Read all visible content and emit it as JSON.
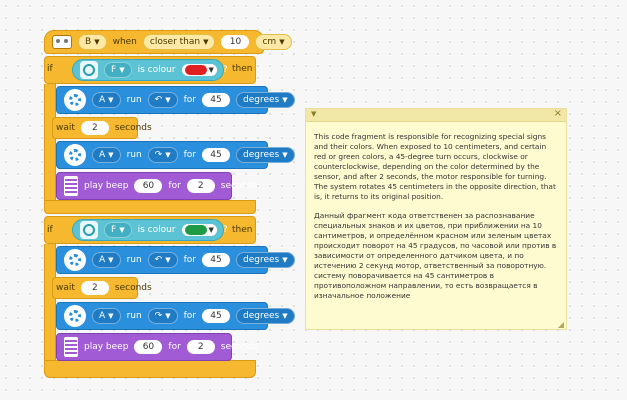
{
  "program": {
    "trigger": {
      "port": "B",
      "when_label": "when",
      "condition": "closer than",
      "value": "10",
      "unit": "cm"
    },
    "if1": {
      "if_label": "if",
      "then_label": "then",
      "port": "F",
      "cond_label": "is colour",
      "color": "#e02020",
      "q": "?",
      "motor1": {
        "port": "A",
        "run_label": "run",
        "for_label": "for",
        "value": "45",
        "unit": "degrees"
      },
      "wait": {
        "label": "wait",
        "value": "2",
        "unit": "seconds"
      },
      "motor2": {
        "port": "A",
        "run_label": "run",
        "for_label": "for",
        "value": "45",
        "unit": "degrees"
      },
      "beep": {
        "label": "play beep",
        "note": "60",
        "for_label": "for",
        "value": "2",
        "unit": "seconds"
      }
    },
    "if2": {
      "if_label": "if",
      "then_label": "then",
      "port": "F",
      "cond_label": "is colour",
      "color": "#1f9a45",
      "q": "?",
      "motor1": {
        "port": "A",
        "run_label": "run",
        "for_label": "for",
        "value": "45",
        "unit": "degrees"
      },
      "wait": {
        "label": "wait",
        "value": "2",
        "unit": "seconds"
      },
      "motor2": {
        "port": "A",
        "run_label": "run",
        "for_label": "for",
        "value": "45",
        "unit": "degrees"
      },
      "beep": {
        "label": "play beep",
        "note": "60",
        "for_label": "for",
        "value": "2",
        "unit": "seconds"
      }
    }
  },
  "note": {
    "paragraph_en": "This code fragment is responsible for recognizing special signs and their colors. When exposed to 10 centimeters, and certain red or green colors, a 45-degree turn occurs, clockwise or counterclockwise, depending on the color determined by the sensor, and after 2 seconds, the motor responsible for turning. The system rotates 45 centimeters in the opposite direction, that is, it returns to its original position.",
    "paragraph_ru": "Данный фрагмент кода ответственен за распознавание специальных знаков и  их цветов, при приближении на 10 сантиметров, и определённом красном или зеленым цветах происходит поворот на 45 градусов, по часовой или против в зависимости от определенного датчиком цвета, и по истечению 2 секунд мотор, ответственный за поворотную. систему поворачивается на 45 сантиметров в противоположном направлении, то есть возвращается в изначальное положение"
  },
  "colors": {
    "event": "#f5b82e",
    "motor": "#2a90dd",
    "sensor": "#5cc3d5",
    "sound": "#a05bd5",
    "note_bg": "#fffbd1"
  }
}
